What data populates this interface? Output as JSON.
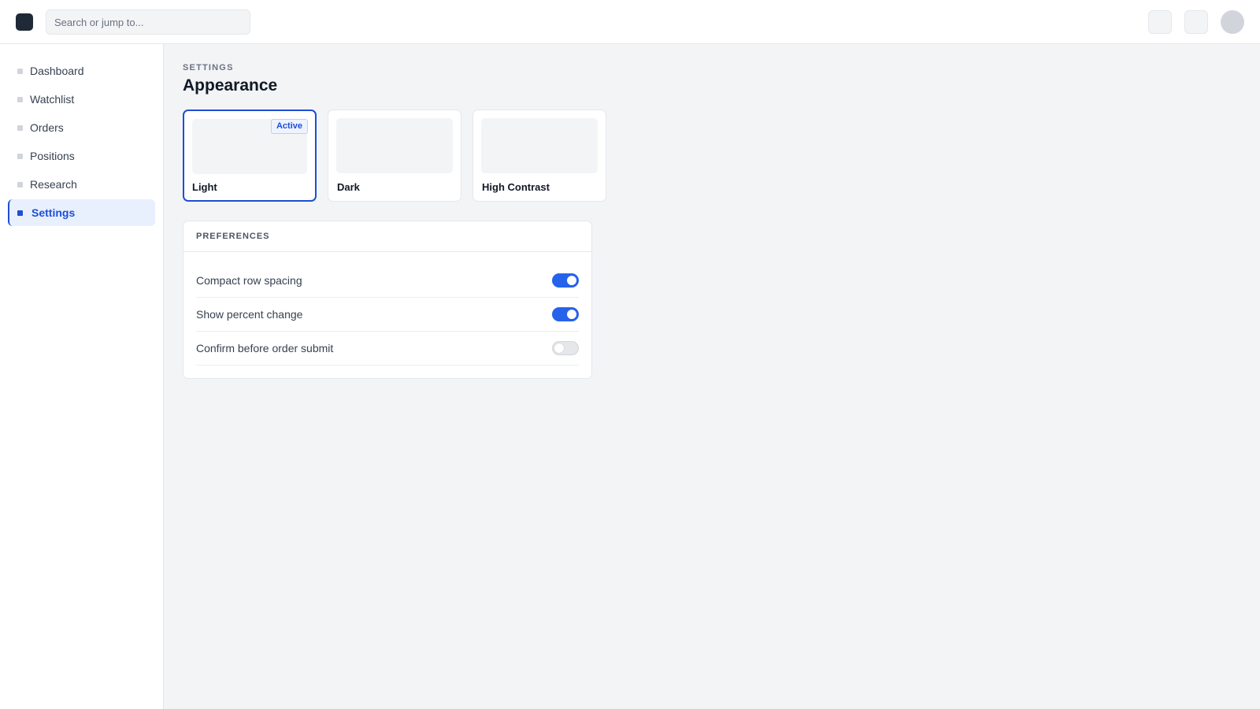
{
  "topbar": {
    "search_placeholder": "Search or jump to..."
  },
  "sidebar": {
    "items": [
      {
        "label": "Dashboard",
        "active": false
      },
      {
        "label": "Watchlist",
        "active": false
      },
      {
        "label": "Orders",
        "active": false
      },
      {
        "label": "Positions",
        "active": false
      },
      {
        "label": "Research",
        "active": false
      },
      {
        "label": "Settings",
        "active": true
      }
    ]
  },
  "main": {
    "eyebrow": "SETTINGS",
    "title": "Appearance",
    "themes": [
      {
        "label": "Light",
        "badge": "Active",
        "selected": true
      },
      {
        "label": "Dark",
        "selected": false
      },
      {
        "label": "High Contrast",
        "selected": false
      }
    ],
    "preferences": {
      "header": "PREFERENCES",
      "rows": [
        {
          "label": "Compact row spacing",
          "enabled": true
        },
        {
          "label": "Show percent change",
          "enabled": true
        },
        {
          "label": "Confirm before order submit",
          "enabled": false
        }
      ]
    }
  },
  "colors": {
    "accent": "#2563eb",
    "active_nav_bg": "#e8f0fe",
    "background": "#f3f4f6"
  }
}
